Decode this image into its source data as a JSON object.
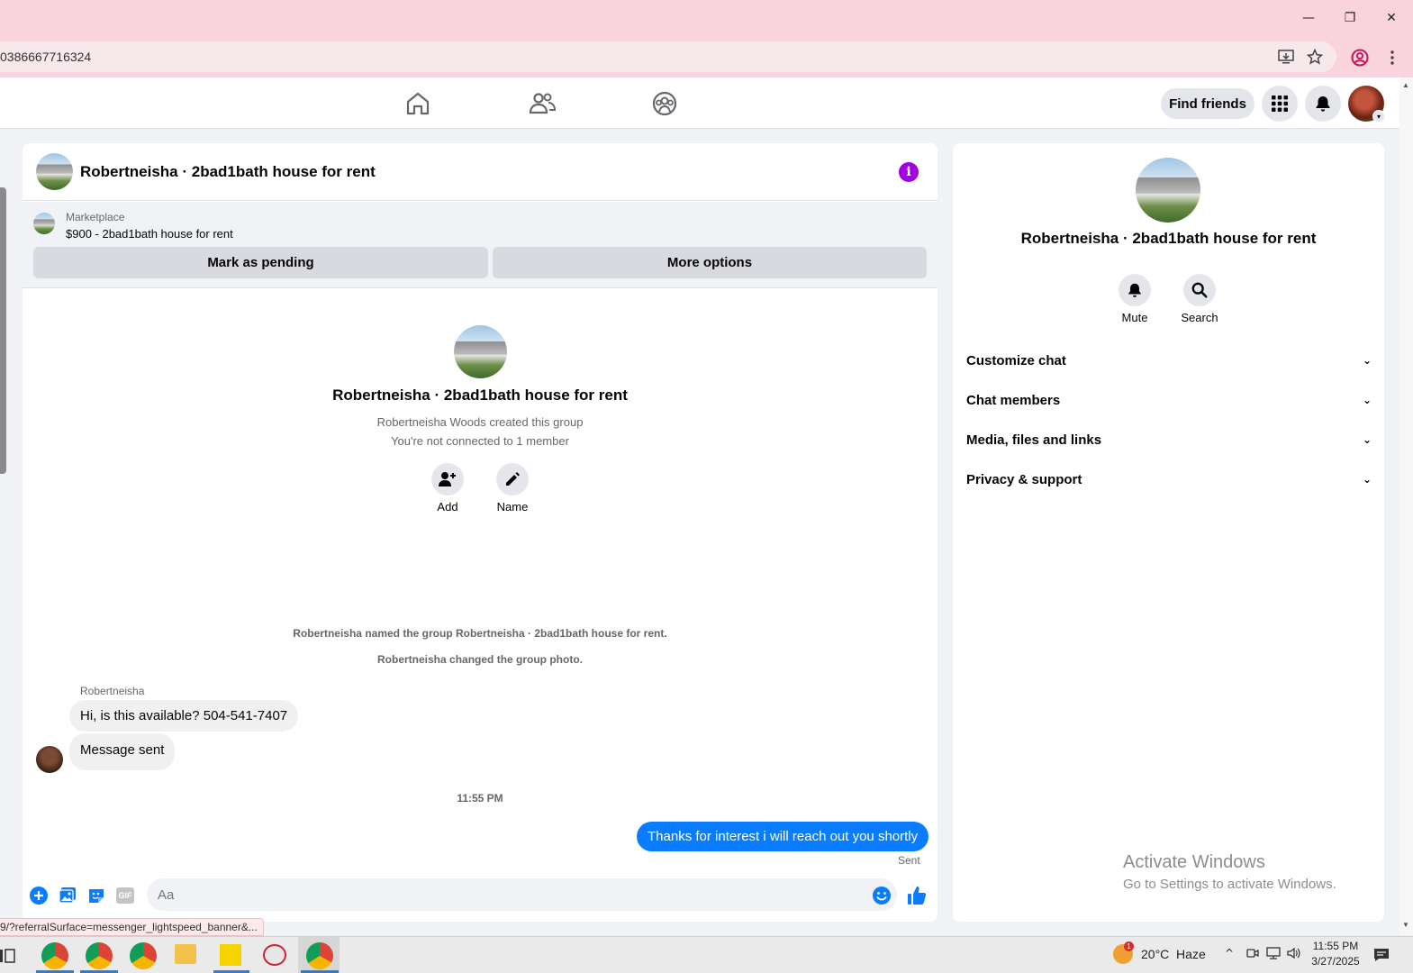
{
  "browser": {
    "url": "0386667716324",
    "window_controls": {
      "minimize": "—",
      "restore": "❐",
      "close": "✕"
    }
  },
  "fb_nav": {
    "find_friends_label": "Find friends"
  },
  "chat": {
    "header_title": "Robertneisha · 2bad1bath house for rent",
    "info_glyph": "i",
    "marketplace": {
      "label": "Marketplace",
      "listing": "$900 - 2bad1bath house for rent",
      "mark_pending_label": "Mark as pending",
      "more_options_label": "More options"
    },
    "group": {
      "title": "Robertneisha · 2bad1bath house for rent",
      "created_by": "Robertneisha Woods created this group",
      "connection": "You're not connected to 1 member",
      "add_label": "Add",
      "name_label": "Name"
    },
    "system_messages": [
      "Robertneisha named the group Robertneisha · 2bad1bath house for rent.",
      "Robertneisha changed the group photo."
    ],
    "sender_name": "Robertneisha",
    "incoming": [
      "Hi, is this available? 504-541-7407",
      "Message sent"
    ],
    "timestamp": "11:55 PM",
    "outgoing": "Thanks for interest i will reach out you shortly",
    "outgoing_status": "Sent",
    "composer": {
      "placeholder": "Aa",
      "gif_label": "GIF"
    }
  },
  "right_panel": {
    "title": "Robertneisha · 2bad1bath house for rent",
    "mute_label": "Mute",
    "search_label": "Search",
    "sections": [
      "Customize chat",
      "Chat members",
      "Media, files and links",
      "Privacy & support"
    ]
  },
  "watermark": {
    "line1": "Activate Windows",
    "line2": "Go to Settings to activate Windows."
  },
  "status_url": "9/?referralSurface=messenger_lightspeed_banner&...",
  "taskbar": {
    "weather": "20°C  Haze",
    "weather_badge": "1",
    "time": "11:55 PM",
    "date": "3/27/2025"
  },
  "colors": {
    "messenger_blue": "#0a7cff",
    "info_purple": "#a200e0",
    "browser_chrome": "#fad4dc"
  }
}
